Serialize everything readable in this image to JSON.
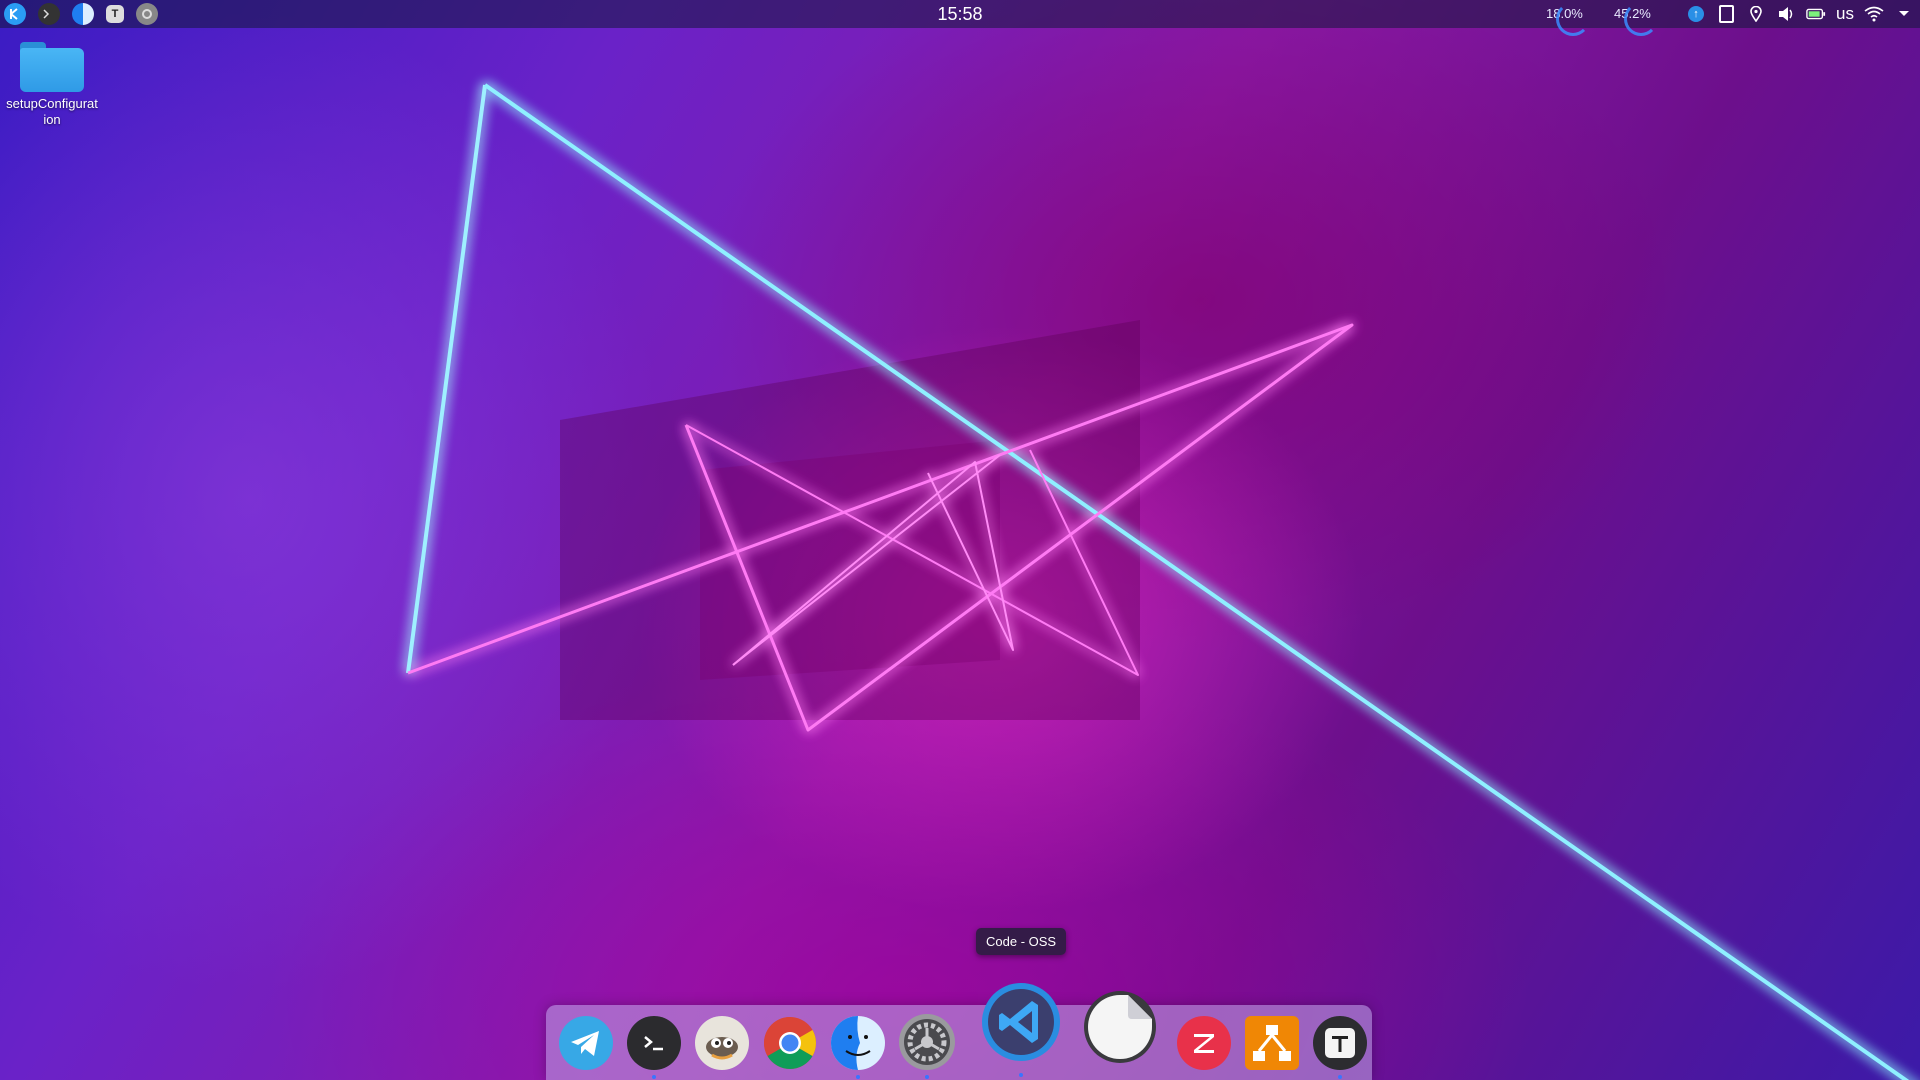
{
  "desktop": {
    "folder_label": "setupConfiguration"
  },
  "top_panel": {
    "clock": "15:58",
    "cpu_usage": "18.0%",
    "memory_usage": "45.2%",
    "keyboard_layout": "us",
    "left_icons": [
      "kde-logo-icon",
      "terminal-icon",
      "finder-icon",
      "typora-icon",
      "settings-icon"
    ],
    "tray_icons": [
      "update-notifier-icon",
      "clipboard-icon",
      "location-icon",
      "volume-icon",
      "battery-icon",
      "wifi-icon",
      "chevron-down-icon"
    ]
  },
  "tooltip": {
    "text": "Code - OSS"
  },
  "dock": {
    "items": [
      {
        "name": "Telegram",
        "icon": "telegram-icon",
        "running": false
      },
      {
        "name": "Terminal",
        "icon": "terminal-icon",
        "running": true
      },
      {
        "name": "GIMP",
        "icon": "gimp-icon",
        "running": false
      },
      {
        "name": "Chrome",
        "icon": "chrome-icon",
        "running": false
      },
      {
        "name": "Finder",
        "icon": "finder-icon",
        "running": true
      },
      {
        "name": "System Settings",
        "icon": "settings-gear-icon",
        "running": true
      },
      {
        "name": "Code - OSS",
        "icon": "vscode-icon",
        "running": true
      },
      {
        "name": "Sticker",
        "icon": "sticker-icon",
        "running": false
      },
      {
        "name": "Zotero",
        "icon": "zotero-icon",
        "running": false
      },
      {
        "name": "Draw.io",
        "icon": "drawio-icon",
        "running": false
      },
      {
        "name": "Typora",
        "icon": "typora-icon",
        "running": true
      }
    ]
  },
  "colors": {
    "neon_cyan": "#7fe8ff",
    "neon_pink": "#ff5af0",
    "accent_blue": "#3a74ff"
  }
}
